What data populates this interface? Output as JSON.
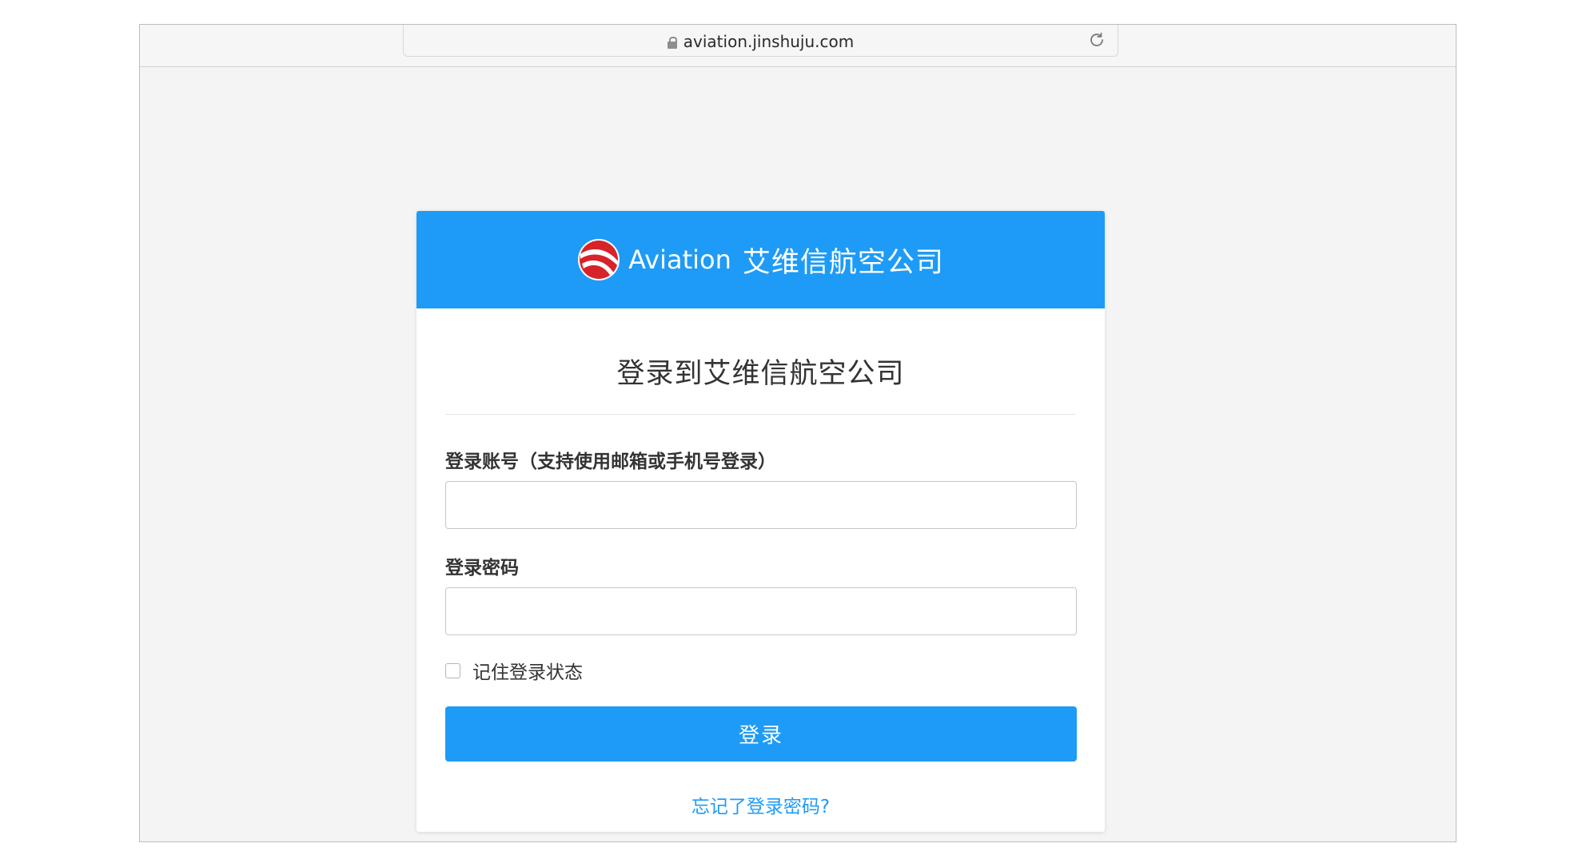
{
  "browser": {
    "url": "aviation.jinshuju.com"
  },
  "header": {
    "brand_name": "Aviation",
    "brand_cn": "艾维信航空公司"
  },
  "form": {
    "title": "登录到艾维信航空公司",
    "account_label": "登录账号（支持使用邮箱或手机号登录）",
    "account_value": "",
    "password_label": "登录密码",
    "password_value": "",
    "remember_label": "记住登录状态",
    "submit_label": "登录",
    "forgot_label": "忘记了登录密码?"
  },
  "colors": {
    "primary": "#1e9bf6",
    "logo_red": "#d8232a",
    "page_bg": "#f4f4f4"
  },
  "icons": [
    "lock-icon",
    "reload-icon",
    "aviation-logo-icon"
  ]
}
